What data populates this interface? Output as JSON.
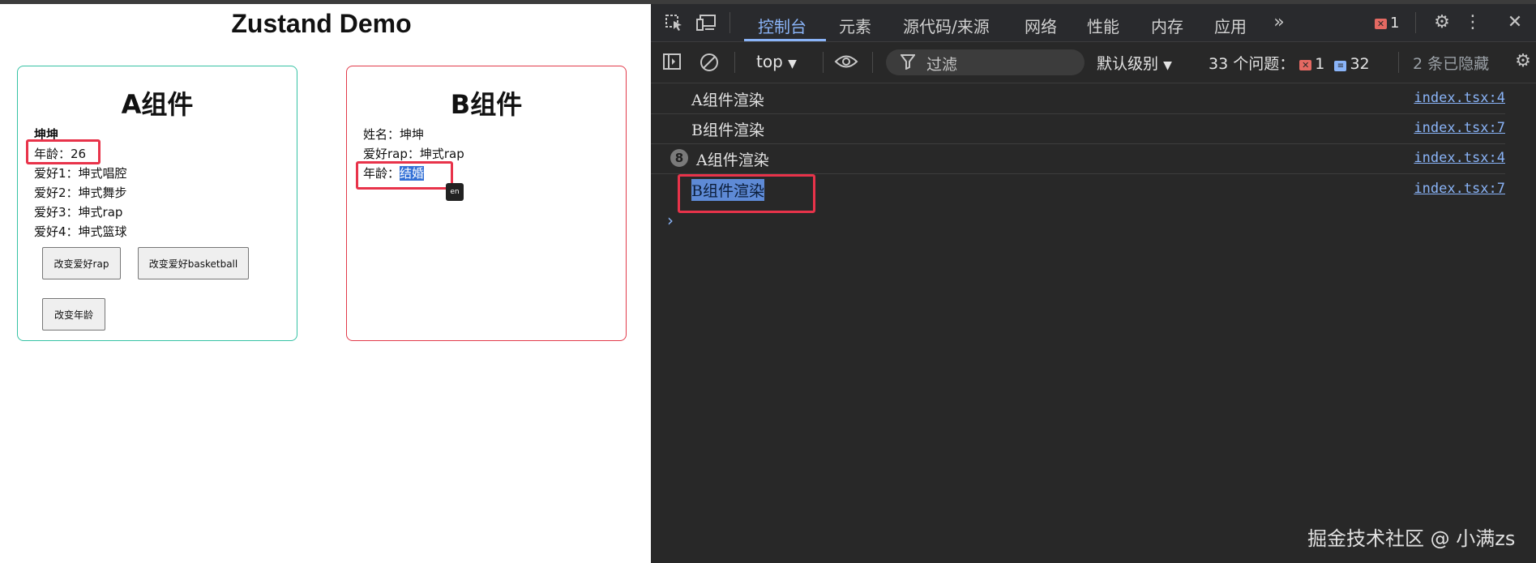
{
  "page": {
    "title": "Zustand Demo",
    "card_a": {
      "title": "A组件",
      "name": "坤坤",
      "age": "年龄：26",
      "hobbies": [
        "爱好1：坤式唱腔",
        "爱好2：坤式舞步",
        "爱好3：坤式rap",
        "爱好4：坤式篮球"
      ],
      "buttons": [
        "改变爱好rap",
        "改变爱好basketball",
        "改变年龄"
      ]
    },
    "card_b": {
      "title": "B组件",
      "name_line": "姓名：坤坤",
      "hobby_line": "爱好rap：坤式rap",
      "age_label": "年龄：",
      "age_value": "结婚",
      "ime_icon": "en"
    },
    "colors": {
      "card_a_border": "#36c2a4",
      "card_b_border": "#e23a4a",
      "highlight": "#e8334a"
    }
  },
  "devtools": {
    "toolbar_icons": [
      "inspect-icon",
      "device-toggle-icon"
    ],
    "tabs": [
      "控制台",
      "元素",
      "源代码/来源",
      "网络",
      "性能",
      "内存",
      "应用"
    ],
    "active_tab": "控制台",
    "more_tabs_icon": "chevron-double-right-icon",
    "error_count": "1",
    "context": "top",
    "filter_placeholder": "过滤",
    "level": "默认级别",
    "issues_label": "33 个问题：",
    "issues_errors": "1",
    "issues_messages": "32",
    "hidden": "2 条已隐藏",
    "logs": [
      {
        "text": "A组件渲染",
        "source": "index.tsx:4",
        "repeat": ""
      },
      {
        "text": "B组件渲染",
        "source": "index.tsx:7",
        "repeat": ""
      },
      {
        "text": "A组件渲染",
        "source": "index.tsx:4",
        "repeat": "8"
      },
      {
        "text": "B组件渲染",
        "source": "index.tsx:7",
        "repeat": ""
      }
    ],
    "prompt": "›"
  },
  "watermark": "掘金技术社区 @ 小满zs"
}
